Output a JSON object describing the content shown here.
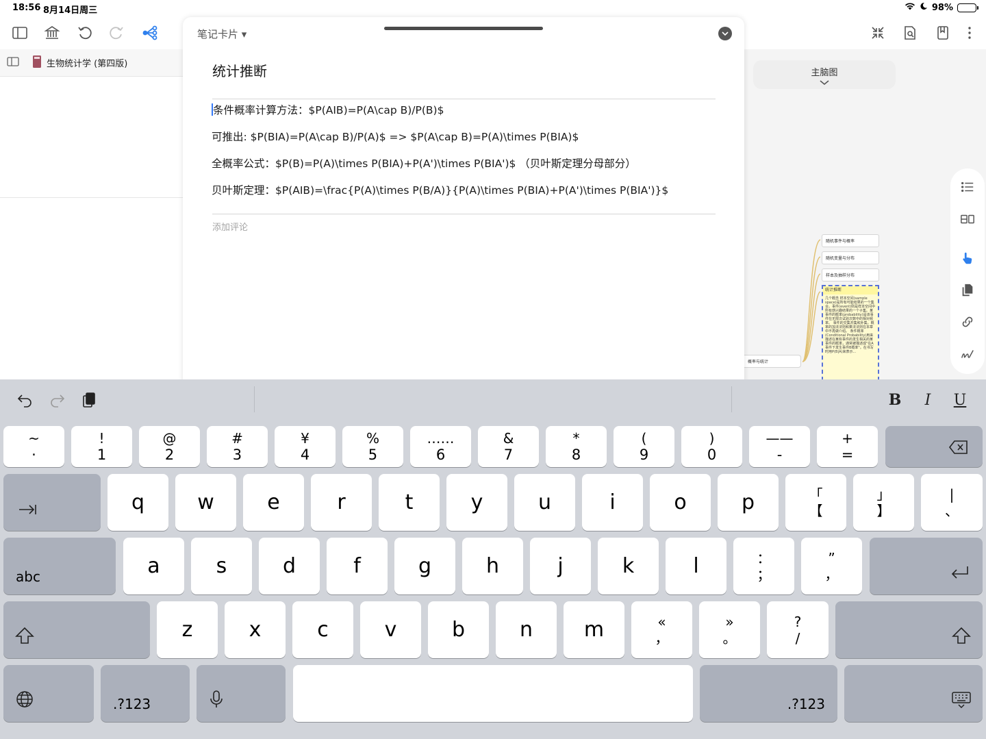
{
  "status": {
    "time": "18:56",
    "date": "8月14日周三",
    "battery": "98%"
  },
  "sidebar": {
    "book_title": "生物统计学 (第四版)"
  },
  "card": {
    "type_label": "笔记卡片 ▾",
    "title": "统计推断",
    "lines": [
      "条件概率计算方法：$P(AIB)=P(A\\cap B)/P(B)$",
      "可推出: $P(BIA)=P(A\\cap B)/P(A)$ => $P(A\\cap B)=P(A)\\times P(BIA)$",
      "全概率公式：$P(B)=P(A)\\times P(BIA)+P(A')\\times P(BIA')$ （贝叶斯定理分母部分）",
      "贝叶斯定理：$P(AIB)=\\frac{P(A)\\times P(B/A)}{P(A)\\times P(BIA)+P(A')\\times P(BIA')}$"
    ],
    "comment_placeholder": "添加评论"
  },
  "mindmap": {
    "title": "主脑图",
    "nodes": [
      "随机事件与概率",
      "随机变量与分布",
      "样本及抽样分布",
      "统计推断",
      "概率与统计"
    ],
    "focus_text": "几个概念 样本空间(sample space)是所有可能结果的一个集合。事件(event)则是样本空间中所有感兴趣结果的一个子集。某事件的概率(probability)是该事件在无限次试验次数中的相对频率。 事件的交集并集和补集。概率的加法法则和乘法法则在本章中不再做介绍。 条件概率(Conditional Probability)用来描述在某些事件的发生相关的某事件的概率，通常被描述成\"在A事件下发生事件B概率\"。在书写时用P(B|A)来表示..."
  },
  "keyboard": {
    "number_row": [
      {
        "top": "~",
        "bot": "·"
      },
      {
        "top": "!",
        "bot": "1"
      },
      {
        "top": "@",
        "bot": "2"
      },
      {
        "top": "#",
        "bot": "3"
      },
      {
        "top": "¥",
        "bot": "4"
      },
      {
        "top": "%",
        "bot": "5"
      },
      {
        "top": "……",
        "bot": "6"
      },
      {
        "top": "&",
        "bot": "7"
      },
      {
        "top": "*",
        "bot": "8"
      },
      {
        "top": "(",
        "bot": "9"
      },
      {
        "top": ")",
        "bot": "0"
      },
      {
        "top": "——",
        "bot": "-"
      },
      {
        "top": "+",
        "bot": "="
      }
    ],
    "row_q": [
      "q",
      "w",
      "e",
      "r",
      "t",
      "y",
      "u",
      "i",
      "o",
      "p"
    ],
    "row_q_extra": [
      {
        "top": "「",
        "bot": "【"
      },
      {
        "top": "」",
        "bot": "】"
      },
      {
        "top": "|",
        "bot": "、"
      }
    ],
    "row_a": [
      "a",
      "s",
      "d",
      "f",
      "g",
      "h",
      "j",
      "k",
      "l"
    ],
    "row_a_extra": [
      {
        "top": "：",
        "bot": "；"
      },
      {
        "top": "”",
        "bot": "，"
      }
    ],
    "row_z": [
      "z",
      "x",
      "c",
      "v",
      "b",
      "n",
      "m"
    ],
    "row_z_extra": [
      {
        "top": "«",
        "bot": "，"
      },
      {
        "top": "»",
        "bot": "。"
      },
      {
        "top": "?",
        "bot": "/"
      }
    ],
    "abc_label": "abc",
    "num_label": ".?123",
    "format": {
      "bold": "B",
      "italic": "I",
      "underline": "U"
    }
  }
}
